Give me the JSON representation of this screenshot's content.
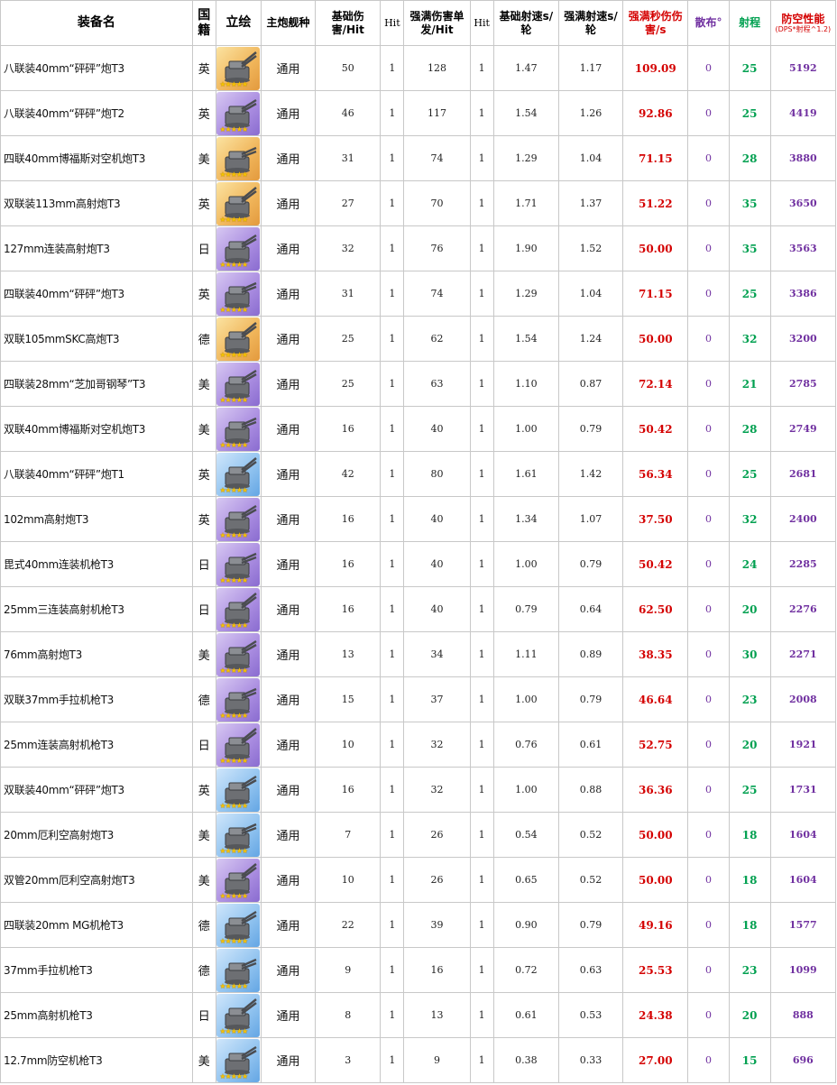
{
  "headers": {
    "name": "装备名",
    "nation": "国籍",
    "art": "立绘",
    "ship_type": "主炮舰种",
    "base_dmg": "基础伤害/Hit",
    "hit1": "Hit",
    "max_dmg": "强满伤害单发/Hit",
    "hit2": "Hit",
    "base_rof": "基础射速s/轮",
    "max_rof": "强满射速s/轮",
    "dps": "强满秒伤伤害/s",
    "spread": "散布°",
    "range": "射程",
    "aa_title": "防空性能",
    "aa_sub": "(DPS*射程^1.2)"
  },
  "rows": [
    {
      "name": "八联装40mm“砰砰”炮T3",
      "nation": "英",
      "rarity": "gold",
      "icon": "octuple-pompom-icon",
      "ship_type": "通用",
      "base_dmg": "50",
      "hit1": "1",
      "max_dmg": "128",
      "hit2": "1",
      "base_rof": "1.47",
      "max_rof": "1.17",
      "dps": "109.09",
      "spread": "0",
      "range": "25",
      "aa": "5192"
    },
    {
      "name": "八联装40mm“砰砰”炮T2",
      "nation": "英",
      "rarity": "purple",
      "icon": "octuple-pompom-icon",
      "ship_type": "通用",
      "base_dmg": "46",
      "hit1": "1",
      "max_dmg": "117",
      "hit2": "1",
      "base_rof": "1.54",
      "max_rof": "1.26",
      "dps": "92.86",
      "spread": "0",
      "range": "25",
      "aa": "4419"
    },
    {
      "name": "四联40mm博福斯对空机炮T3",
      "nation": "美",
      "rarity": "gold",
      "icon": "quad-bofors-icon",
      "ship_type": "通用",
      "base_dmg": "31",
      "hit1": "1",
      "max_dmg": "74",
      "hit2": "1",
      "base_rof": "1.29",
      "max_rof": "1.04",
      "dps": "71.15",
      "spread": "0",
      "range": "28",
      "aa": "3880"
    },
    {
      "name": "双联装113mm高射炮T3",
      "nation": "英",
      "rarity": "gold",
      "icon": "twin-113mm-icon",
      "ship_type": "通用",
      "base_dmg": "27",
      "hit1": "1",
      "max_dmg": "70",
      "hit2": "1",
      "base_rof": "1.71",
      "max_rof": "1.37",
      "dps": "51.22",
      "spread": "0",
      "range": "35",
      "aa": "3650"
    },
    {
      "name": "127mm连装高射炮T3",
      "nation": "日",
      "rarity": "purple",
      "icon": "twin-127mm-icon",
      "ship_type": "通用",
      "base_dmg": "32",
      "hit1": "1",
      "max_dmg": "76",
      "hit2": "1",
      "base_rof": "1.90",
      "max_rof": "1.52",
      "dps": "50.00",
      "spread": "0",
      "range": "35",
      "aa": "3563"
    },
    {
      "name": "四联装40mm“砰砰”炮T3",
      "nation": "英",
      "rarity": "purple",
      "icon": "quad-pompom-icon",
      "ship_type": "通用",
      "base_dmg": "31",
      "hit1": "1",
      "max_dmg": "74",
      "hit2": "1",
      "base_rof": "1.29",
      "max_rof": "1.04",
      "dps": "71.15",
      "spread": "0",
      "range": "25",
      "aa": "3386"
    },
    {
      "name": "双联105mmSKC高炮T3",
      "nation": "德",
      "rarity": "gold",
      "icon": "twin-105mm-icon",
      "ship_type": "通用",
      "base_dmg": "25",
      "hit1": "1",
      "max_dmg": "62",
      "hit2": "1",
      "base_rof": "1.54",
      "max_rof": "1.24",
      "dps": "50.00",
      "spread": "0",
      "range": "32",
      "aa": "3200"
    },
    {
      "name": "四联装28mm“芝加哥钢琴”T3",
      "nation": "美",
      "rarity": "purple",
      "icon": "chicago-piano-icon",
      "ship_type": "通用",
      "base_dmg": "25",
      "hit1": "1",
      "max_dmg": "63",
      "hit2": "1",
      "base_rof": "1.10",
      "max_rof": "0.87",
      "dps": "72.14",
      "spread": "0",
      "range": "21",
      "aa": "2785"
    },
    {
      "name": "双联40mm博福斯对空机炮T3",
      "nation": "美",
      "rarity": "purple",
      "icon": "twin-bofors-icon",
      "ship_type": "通用",
      "base_dmg": "16",
      "hit1": "1",
      "max_dmg": "40",
      "hit2": "1",
      "base_rof": "1.00",
      "max_rof": "0.79",
      "dps": "50.42",
      "spread": "0",
      "range": "28",
      "aa": "2749"
    },
    {
      "name": "八联装40mm“砰砰”炮T1",
      "nation": "英",
      "rarity": "blue",
      "icon": "octuple-pompom-icon",
      "ship_type": "通用",
      "base_dmg": "42",
      "hit1": "1",
      "max_dmg": "80",
      "hit2": "1",
      "base_rof": "1.61",
      "max_rof": "1.42",
      "dps": "56.34",
      "spread": "0",
      "range": "25",
      "aa": "2681"
    },
    {
      "name": "102mm高射炮T3",
      "nation": "英",
      "rarity": "purple",
      "icon": "102mm-gun-icon",
      "ship_type": "通用",
      "base_dmg": "16",
      "hit1": "1",
      "max_dmg": "40",
      "hit2": "1",
      "base_rof": "1.34",
      "max_rof": "1.07",
      "dps": "37.50",
      "spread": "0",
      "range": "32",
      "aa": "2400"
    },
    {
      "name": "毘式40mm连装机枪T3",
      "nation": "日",
      "rarity": "purple",
      "icon": "vickers-40mm-icon",
      "ship_type": "通用",
      "base_dmg": "16",
      "hit1": "1",
      "max_dmg": "40",
      "hit2": "1",
      "base_rof": "1.00",
      "max_rof": "0.79",
      "dps": "50.42",
      "spread": "0",
      "range": "24",
      "aa": "2285"
    },
    {
      "name": "25mm三连装高射机枪T3",
      "nation": "日",
      "rarity": "purple",
      "icon": "triple-25mm-icon",
      "ship_type": "通用",
      "base_dmg": "16",
      "hit1": "1",
      "max_dmg": "40",
      "hit2": "1",
      "base_rof": "0.79",
      "max_rof": "0.64",
      "dps": "62.50",
      "spread": "0",
      "range": "20",
      "aa": "2276"
    },
    {
      "name": "76mm高射炮T3",
      "nation": "美",
      "rarity": "purple",
      "icon": "76mm-gun-icon",
      "ship_type": "通用",
      "base_dmg": "13",
      "hit1": "1",
      "max_dmg": "34",
      "hit2": "1",
      "base_rof": "1.11",
      "max_rof": "0.89",
      "dps": "38.35",
      "spread": "0",
      "range": "30",
      "aa": "2271"
    },
    {
      "name": "双联37mm手拉机枪T3",
      "nation": "德",
      "rarity": "purple",
      "icon": "twin-37mm-icon",
      "ship_type": "通用",
      "base_dmg": "15",
      "hit1": "1",
      "max_dmg": "37",
      "hit2": "1",
      "base_rof": "1.00",
      "max_rof": "0.79",
      "dps": "46.64",
      "spread": "0",
      "range": "23",
      "aa": "2008"
    },
    {
      "name": "25mm连装高射机枪T3",
      "nation": "日",
      "rarity": "purple",
      "icon": "twin-25mm-icon",
      "ship_type": "通用",
      "base_dmg": "10",
      "hit1": "1",
      "max_dmg": "32",
      "hit2": "1",
      "base_rof": "0.76",
      "max_rof": "0.61",
      "dps": "52.75",
      "spread": "0",
      "range": "20",
      "aa": "1921"
    },
    {
      "name": "双联装40mm“砰砰”炮T3",
      "nation": "英",
      "rarity": "blue",
      "icon": "twin-pompom-icon",
      "ship_type": "通用",
      "base_dmg": "16",
      "hit1": "1",
      "max_dmg": "32",
      "hit2": "1",
      "base_rof": "1.00",
      "max_rof": "0.88",
      "dps": "36.36",
      "spread": "0",
      "range": "25",
      "aa": "1731"
    },
    {
      "name": "20mm厄利空高射炮T3",
      "nation": "美",
      "rarity": "blue",
      "icon": "oerlikon-20mm-icon",
      "ship_type": "通用",
      "base_dmg": "7",
      "hit1": "1",
      "max_dmg": "26",
      "hit2": "1",
      "base_rof": "0.54",
      "max_rof": "0.52",
      "dps": "50.00",
      "spread": "0",
      "range": "18",
      "aa": "1604"
    },
    {
      "name": "双管20mm厄利空高射炮T3",
      "nation": "美",
      "rarity": "purple",
      "icon": "twin-oerlikon-icon",
      "ship_type": "通用",
      "base_dmg": "10",
      "hit1": "1",
      "max_dmg": "26",
      "hit2": "1",
      "base_rof": "0.65",
      "max_rof": "0.52",
      "dps": "50.00",
      "spread": "0",
      "range": "18",
      "aa": "1604"
    },
    {
      "name": "四联装20mm MG机枪T3",
      "nation": "德",
      "rarity": "blue",
      "icon": "quad-20mm-mg-icon",
      "ship_type": "通用",
      "base_dmg": "22",
      "hit1": "1",
      "max_dmg": "39",
      "hit2": "1",
      "base_rof": "0.90",
      "max_rof": "0.79",
      "dps": "49.16",
      "spread": "0",
      "range": "18",
      "aa": "1577"
    },
    {
      "name": "37mm手拉机枪T3",
      "nation": "德",
      "rarity": "blue",
      "icon": "37mm-mg-icon",
      "ship_type": "通用",
      "base_dmg": "9",
      "hit1": "1",
      "max_dmg": "16",
      "hit2": "1",
      "base_rof": "0.72",
      "max_rof": "0.63",
      "dps": "25.53",
      "spread": "0",
      "range": "23",
      "aa": "1099"
    },
    {
      "name": "25mm高射机枪T3",
      "nation": "日",
      "rarity": "blue",
      "icon": "25mm-mg-icon",
      "ship_type": "通用",
      "base_dmg": "8",
      "hit1": "1",
      "max_dmg": "13",
      "hit2": "1",
      "base_rof": "0.61",
      "max_rof": "0.53",
      "dps": "24.38",
      "spread": "0",
      "range": "20",
      "aa": "888"
    },
    {
      "name": "12.7mm防空机枪T3",
      "nation": "美",
      "rarity": "blue",
      "icon": "12-7mm-mg-icon",
      "ship_type": "通用",
      "base_dmg": "3",
      "hit1": "1",
      "max_dmg": "9",
      "hit2": "1",
      "base_rof": "0.38",
      "max_rof": "0.33",
      "dps": "27.00",
      "spread": "0",
      "range": "15",
      "aa": "696"
    }
  ]
}
